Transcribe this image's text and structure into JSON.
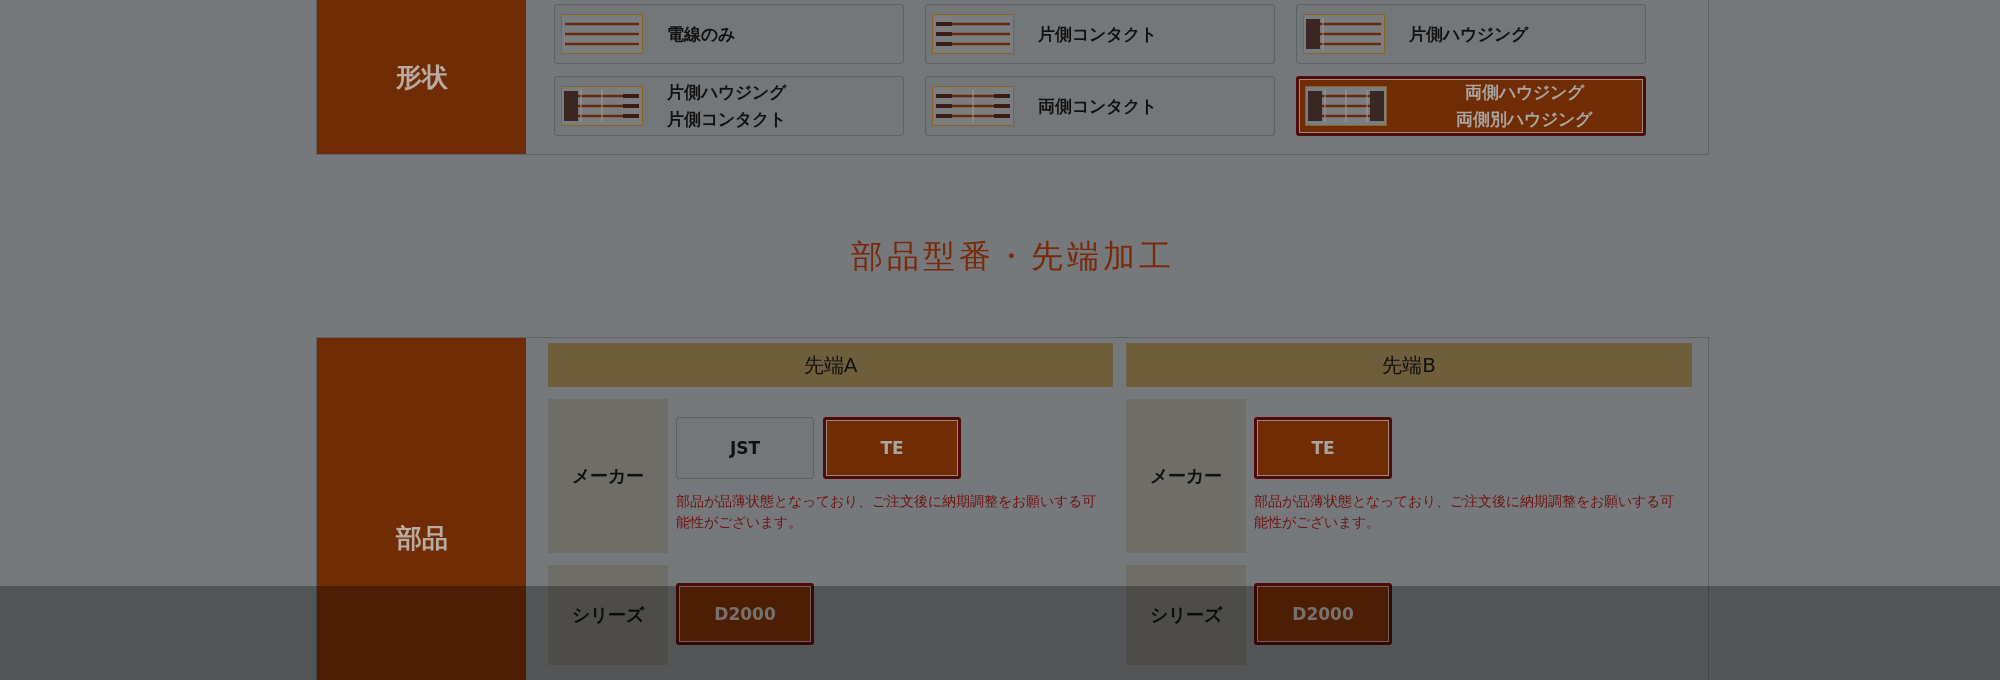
{
  "shape_section": {
    "label": "形状",
    "options": [
      {
        "lines": [
          "電線のみ"
        ],
        "kind": "wire",
        "selected": false
      },
      {
        "lines": [
          "片側コンタクト"
        ],
        "kind": "one-contact",
        "selected": false
      },
      {
        "lines": [
          "片側ハウジング"
        ],
        "kind": "one-housing",
        "selected": false
      },
      {
        "lines": [
          "片側ハウジング",
          "片側コンタクト"
        ],
        "kind": "housing-contact",
        "selected": false
      },
      {
        "lines": [
          "両側コンタクト"
        ],
        "kind": "both-contact",
        "selected": false
      },
      {
        "lines": [
          "両側ハウジング",
          "両側別ハウジング"
        ],
        "kind": "both-housing",
        "selected": true
      }
    ]
  },
  "heading": "部品型番・先端加工",
  "parts_section": {
    "label": "部品",
    "ends": [
      {
        "title": "先端A",
        "rows": [
          {
            "label": "メーカー",
            "options": [
              {
                "label": "JST",
                "selected": false
              },
              {
                "label": "TE",
                "selected": true
              }
            ],
            "note": "部品が品薄状態となっており、ご注文後に納期調整をお願いする可能性がございます。"
          },
          {
            "label": "シリーズ",
            "options": [
              {
                "label": "D2000",
                "selected": true
              }
            ]
          }
        ]
      },
      {
        "title": "先端B",
        "rows": [
          {
            "label": "メーカー",
            "options": [
              {
                "label": "TE",
                "selected": true
              }
            ],
            "note": "部品が品薄状態となっており、ご注文後に納期調整をお願いする可能性がございます。"
          },
          {
            "label": "シリーズ",
            "options": [
              {
                "label": "D2000",
                "selected": true
              }
            ]
          }
        ]
      }
    ]
  }
}
